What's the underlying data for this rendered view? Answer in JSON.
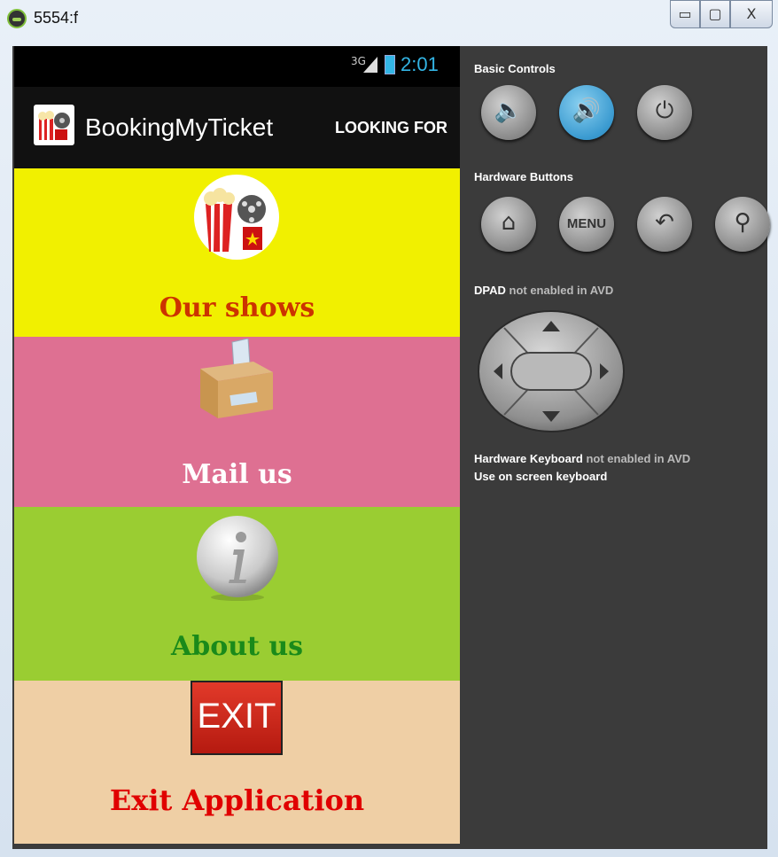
{
  "window": {
    "title": "5554:f",
    "buttons": {
      "minimize": "▭",
      "maximize": "▢",
      "close": "X"
    }
  },
  "statusbar": {
    "network": "3G",
    "time": "2:01"
  },
  "actionbar": {
    "title": "BookingMyTicket",
    "action": "LOOKING FOR"
  },
  "tiles": [
    {
      "label": "Our shows",
      "color": "#f1f000",
      "text_color": "#cc3300"
    },
    {
      "label": "Mail us",
      "color": "#de7092",
      "text_color": "#ffffff"
    },
    {
      "label": "About us",
      "color": "#9acd32",
      "text_color": "#1a8a1a"
    },
    {
      "label": "Exit Application",
      "color": "#efcfa5",
      "text_color": "#e00000",
      "icon_text": "EXIT"
    }
  ],
  "panel": {
    "basic_controls": "Basic Controls",
    "hardware_buttons": "Hardware Buttons",
    "menu_label": "MENU",
    "dpad_label": "DPAD",
    "dpad_note": "not enabled in AVD",
    "keyboard_label": "Hardware Keyboard",
    "keyboard_note": "not enabled in AVD",
    "keyboard_hint": "Use on screen keyboard"
  },
  "icons": {
    "volume_down": "volume-down-icon",
    "volume_up": "volume-up-icon",
    "power": "power-icon",
    "home": "home-icon",
    "back": "back-icon",
    "search": "search-icon"
  },
  "colors": {
    "accent": "#33b5e5",
    "panel": "#3b3b3b"
  }
}
